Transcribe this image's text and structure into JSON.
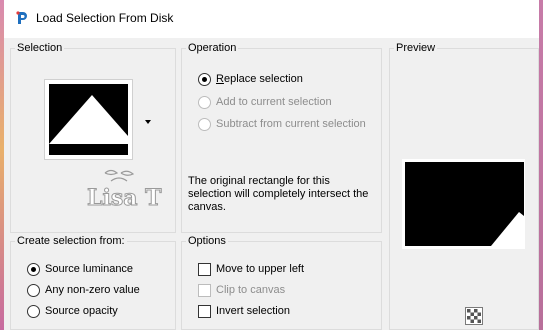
{
  "window": {
    "title": "Load Selection From Disk"
  },
  "selection_group": {
    "label": "Selection"
  },
  "operation_group": {
    "label": "Operation",
    "options": [
      {
        "label": "Replace selection",
        "checked": true,
        "enabled": true
      },
      {
        "label": "Add to current selection",
        "checked": false,
        "enabled": false
      },
      {
        "label": "Subtract from current selection",
        "checked": false,
        "enabled": false
      }
    ],
    "info": "The original rectangle for this selection will completely intersect the canvas."
  },
  "preview_group": {
    "label": "Preview"
  },
  "create_group": {
    "label": "Create selection from:",
    "options": [
      {
        "label": "Source luminance",
        "checked": true
      },
      {
        "label": "Any non-zero value",
        "checked": false
      },
      {
        "label": "Source opacity",
        "checked": false
      }
    ]
  },
  "options_group": {
    "label": "Options",
    "options": [
      {
        "label": "Move to upper left",
        "checked": false,
        "enabled": true
      },
      {
        "label": "Clip to canvas",
        "checked": false,
        "enabled": false
      },
      {
        "label": "Invert selection",
        "checked": false,
        "enabled": true
      }
    ]
  },
  "watermark": {
    "text": "Lisa T"
  },
  "colors": {
    "accent": "#1e6fbf",
    "disabled_text": "#8d8d8d",
    "title_bg": "#ffffff",
    "dialog_bg": "#f0f0f0"
  },
  "icons": {
    "app": "paintshop-pro-icon",
    "dropdown": "triangle-down-icon",
    "zoom": "checkerboard-icon"
  }
}
